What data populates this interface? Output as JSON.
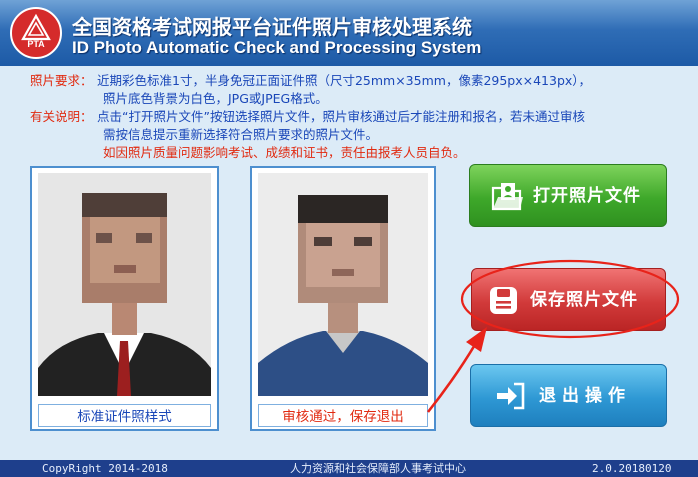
{
  "app": {
    "title_cn": "全国资格考试网报平台证件照片审核处理系统",
    "title_en": "ID Photo Automatic Check and Processing System",
    "logo_text": "PTA"
  },
  "requirements": {
    "label": "照片要求：",
    "line1": "近期彩色标准1寸，半身免冠正面证件照（尺寸25mm×35mm，像素295px×413px），",
    "line2": "照片底色背景为白色，JPG或JPEG格式。"
  },
  "instructions": {
    "label": "有关说明：",
    "line1": "点击“打开照片文件”按钮选择照片文件，照片审核通过后才能注册和报名，若未通过审核",
    "line2": "需按信息提示重新选择符合照片要求的照片文件。",
    "warning": "如因照片质量问题影响考试、成绩和证书，责任由报考人员自负。"
  },
  "photos": {
    "sample_caption": "标准证件照样式",
    "result_caption": "审核通过，保存退出"
  },
  "buttons": {
    "open": "打开照片文件",
    "save": "保存照片文件",
    "exit": "退出操作"
  },
  "footer": {
    "copyright": "CopyRight 2014-2018",
    "org": "人力资源和社会保障部人事考试中心",
    "version": "2.0.20180120"
  },
  "colors": {
    "title_bar": "#2f6db6",
    "label_red": "#e12a10",
    "text_blue": "#1a47b8",
    "open_green": "#3ea82a",
    "save_red": "#d13a3a",
    "exit_blue": "#2e98d4",
    "annotation_red": "#e8231a",
    "footer_bg": "#1e3f8c"
  }
}
